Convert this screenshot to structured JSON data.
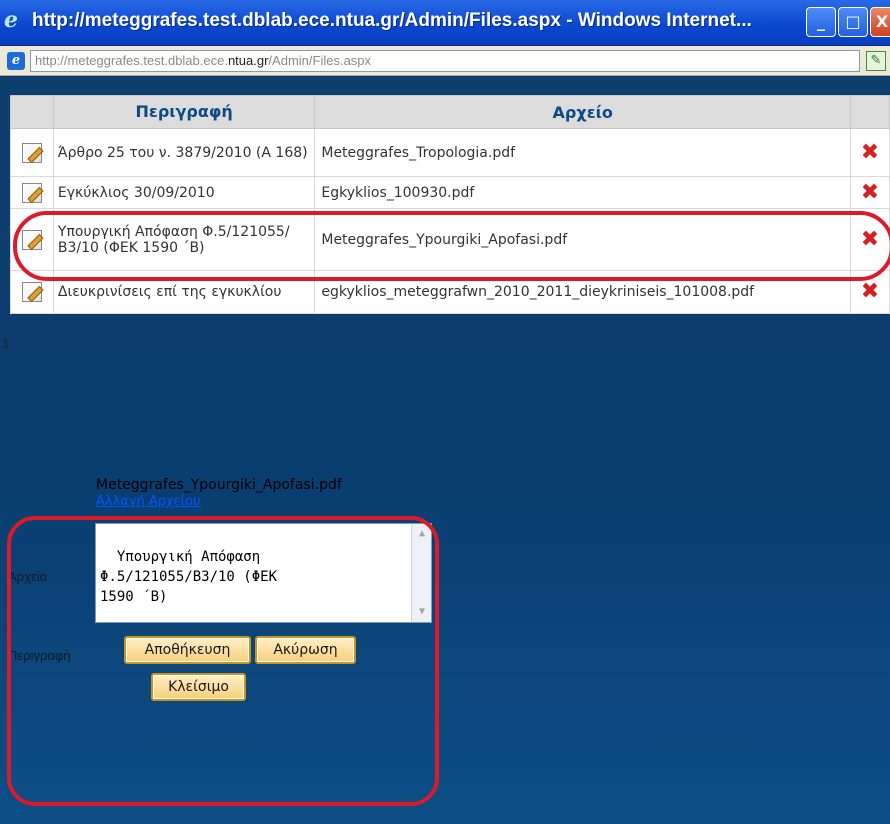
{
  "window": {
    "title": "http://meteggrafes.test.dblab.ece.ntua.gr/Admin/Files.aspx - Windows Internet...",
    "minimize": "_",
    "maximize": "□",
    "close": "X"
  },
  "address": {
    "url_prefix": "http://meteggrafes.test.dblab.ece.",
    "url_host": "ntua.gr",
    "url_suffix": "/Admin/Files.aspx"
  },
  "table": {
    "headers": [
      "",
      "Περιγραφή",
      "Αρχείο",
      ""
    ],
    "rows": [
      {
        "description": "Άρθρο 25 του ν. 3879/2010 (Α 168)",
        "file": "Meteggrafes_Tropologia.pdf"
      },
      {
        "description": "Εγκύκλιος 30/09/2010",
        "file": "Egkyklios_100930.pdf"
      },
      {
        "description": "Υπουργική Απόφαση Φ.5/121055/Β3/10 (ΦΕΚ 1590 ΄Β)",
        "file": "Meteggrafes_Ypourgiki_Apofasi.pdf"
      },
      {
        "description": "Διευκρινίσεις επί της εγκυκλίου",
        "file": "egkyklios_meteggrafwn_2010_2011_dieykriniseis_101008.pdf"
      }
    ],
    "page_number": "1"
  },
  "form": {
    "file_label": "Αρχείο",
    "file_value": "Meteggrafes_Ypourgiki_Apofasi.pdf",
    "change_file_link": "Αλλαγή Αρχείου",
    "description_label": "Περιγραφή",
    "description_value": "Υπουργική Απόφαση\nΦ.5/121055/Β3/10 (ΦΕΚ\n1590 ΄Β)",
    "save_button": "Αποθήκευση",
    "cancel_button": "Ακύρωση",
    "close_button": "Κλείσιμο"
  },
  "colors": {
    "accent_annotation": "#dd1a2a",
    "page_background": "#0a3c6e",
    "header_text": "#0d4a86",
    "delete_icon": "#d42020"
  }
}
